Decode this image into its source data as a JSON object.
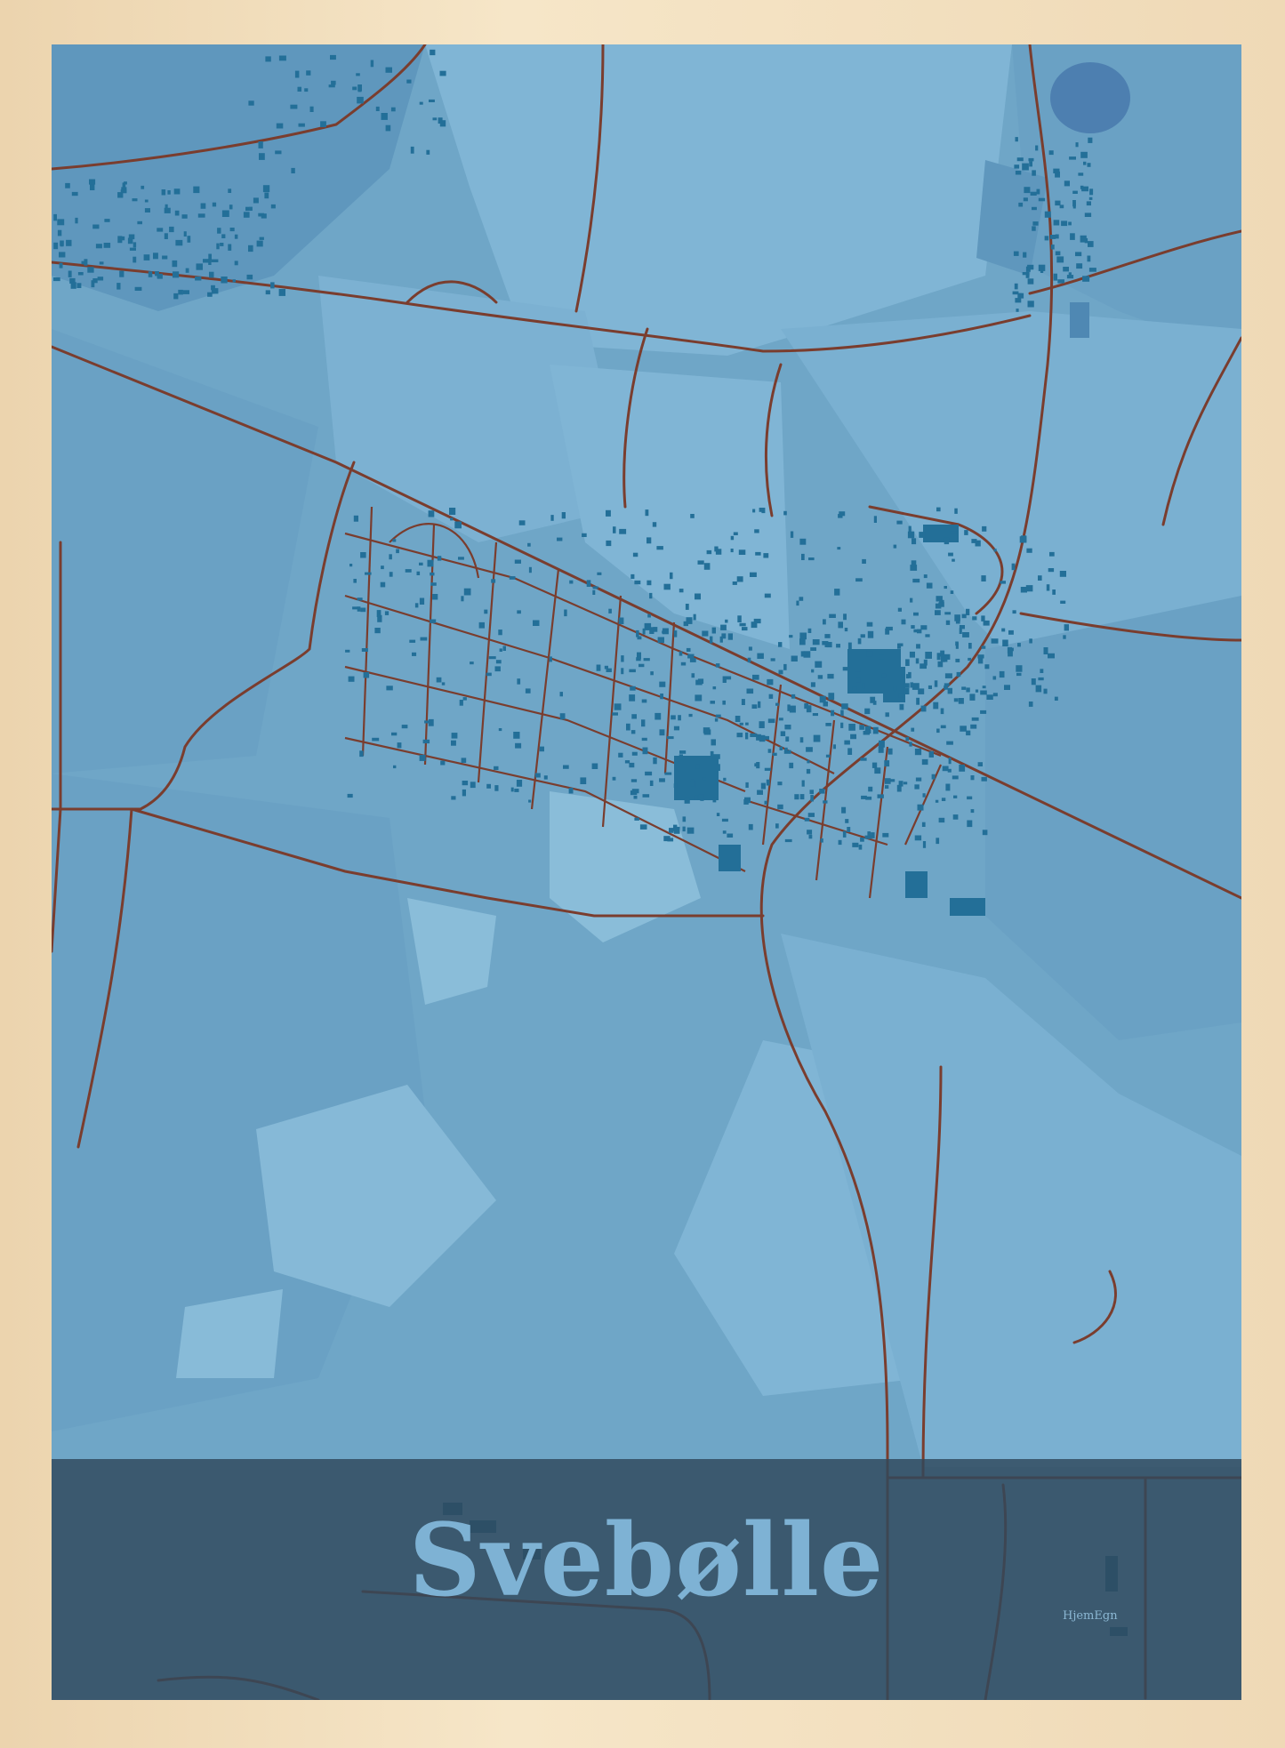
{
  "poster": {
    "title": "Svebølle",
    "brand": "HjemEgn"
  },
  "colors": {
    "frame": "#f1dcbb",
    "water_base": "#6fa6c7",
    "land_light": "#80b5d5",
    "land_dark": "#5f97bd",
    "buildings": "#236f98",
    "roads": "#7a3d2e",
    "band": "#2f485c",
    "title_text": "#7eb2d4"
  }
}
